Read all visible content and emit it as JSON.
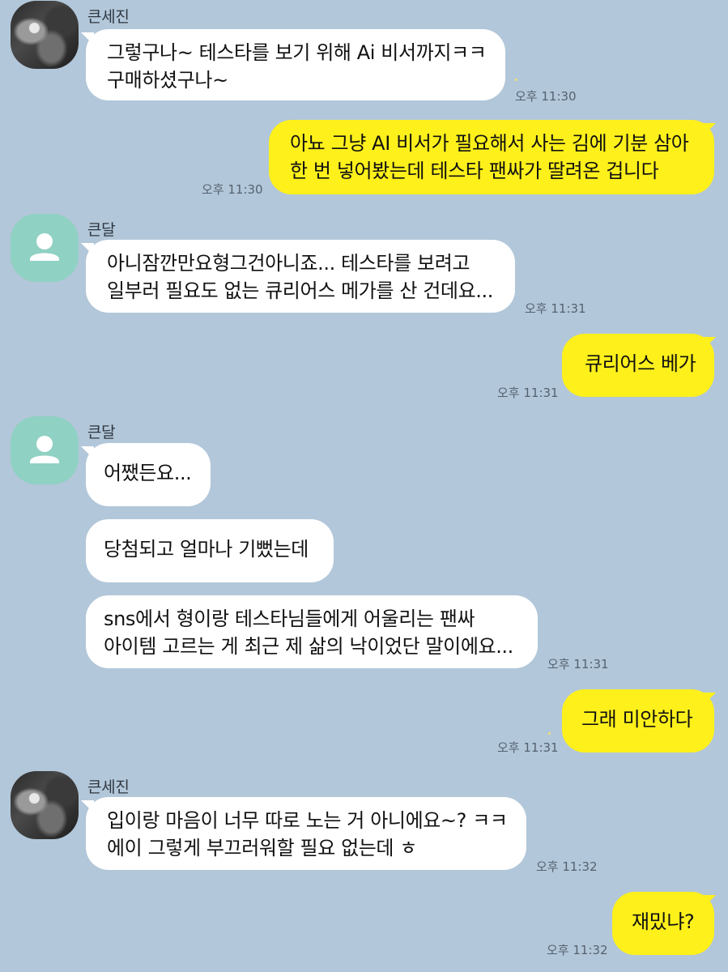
{
  "messages": [
    {
      "sender": "큰세진",
      "lines": [
        "그렇구나~ 테스타를 보기 위해 Ai 비서까지ㅋㅋ",
        "구매하셨구나~"
      ],
      "time": "오후 11:30",
      "direction": "in"
    },
    {
      "lines": [
        "아뇨 그냥 AI 비서가 필요해서 사는 김에 기분 삼아",
        "한 번 넣어봤는데 테스타 팬싸가 딸려온 겁니다"
      ],
      "time": "오후 11:30",
      "direction": "out"
    },
    {
      "sender": "큰달",
      "lines": [
        "아니잠깐만요형그건아니죠... 테스타를 보려고",
        "일부러 필요도 없는 큐리어스 메가를 산 건데요..."
      ],
      "time": "오후 11:31",
      "direction": "in"
    },
    {
      "lines": [
        "큐리어스 베가"
      ],
      "time": "오후 11:31",
      "direction": "out"
    },
    {
      "sender": "큰달",
      "lines": [
        "어쨌든요..."
      ],
      "direction": "in"
    },
    {
      "lines": [
        "당첨되고 얼마나 기뻤는데"
      ],
      "direction": "in"
    },
    {
      "lines": [
        "sns에서 형이랑 테스타님들에게 어울리는 팬싸",
        "아이템 고르는 게 최근 제 삶의 낙이었단 말이에요..."
      ],
      "time": "오후 11:31",
      "direction": "in"
    },
    {
      "lines": [
        "그래 미안하다"
      ],
      "time": "오후 11:31",
      "direction": "out"
    },
    {
      "sender": "큰세진",
      "lines": [
        "입이랑 마음이 너무 따로 노는 거 아니에요~? ㅋㅋ",
        "에이 그렇게 부끄러워할 필요 없는데 ㅎ"
      ],
      "time": "오후 11:32",
      "direction": "in"
    },
    {
      "lines": [
        "재밌냐?"
      ],
      "time": "오후 11:32",
      "direction": "out"
    }
  ],
  "icons": {
    "photo_avatar": "profile-photo",
    "default_avatar": "person-icon"
  },
  "colors": {
    "background": "#b2c7d9",
    "incoming_bubble": "#ffffff",
    "outgoing_bubble": "#fef01b",
    "default_avatar": "#8fd1c3"
  }
}
